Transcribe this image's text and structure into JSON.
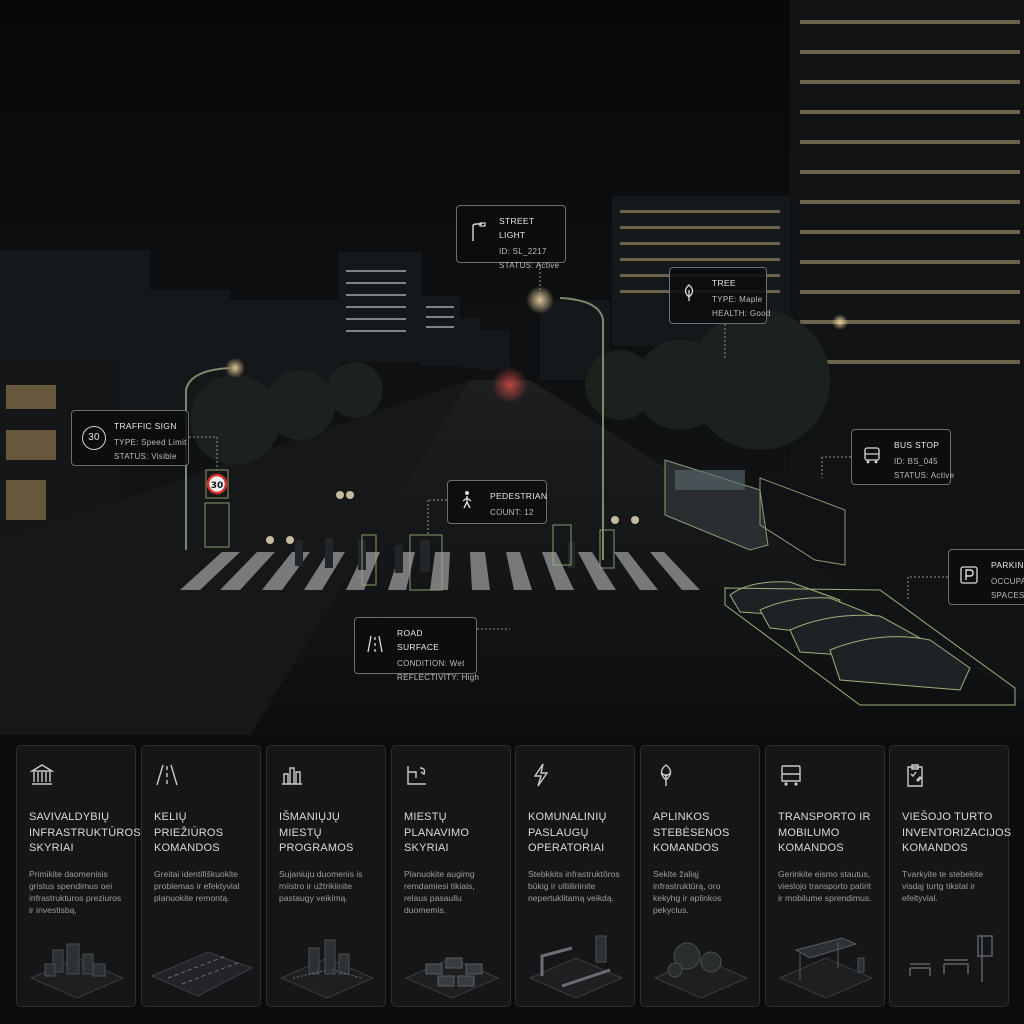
{
  "callouts": {
    "street_light": {
      "title": "STREET LIGHT",
      "line1": "ID: SL_2217",
      "line2": "STATUS: Active"
    },
    "tree": {
      "title": "TREE",
      "line1": "TYPE: Maple",
      "line2": "HEALTH: Good"
    },
    "traffic_sign": {
      "title": "TRAFFIC SIGN",
      "icon_text": "30",
      "line1": "TYPE: Speed Limit",
      "line2": "STATUS: Visible"
    },
    "bus_stop": {
      "title": "BUS STOP",
      "line1": "ID: BS_045",
      "line2": "STATUS: Active"
    },
    "pedestrian": {
      "title": "PEDESTRIAN",
      "line1": "COUNT: 12"
    },
    "parking": {
      "title": "PARKING",
      "line1": "OCCUPA",
      "line2": "SPACES F"
    },
    "road_surface": {
      "title": "ROAD SURFACE",
      "line1": "CONDITION: Wet",
      "line2": "REFLECTIVITY: High"
    },
    "sign_marker": "30"
  },
  "cards": [
    {
      "icon": "bank-icon",
      "title": "SAVIVALDYBIŲ INFRASTRUKTŪROS SKYRIAI",
      "desc": "Primikite daomenisis gristus spendimus oei infrastrukturos preziuros ir investisbą."
    },
    {
      "icon": "road-icon",
      "title": "KELIŲ PRIEŽIŪROS KOMANDOS",
      "desc": "Greitai identifiškuokite problemas ir efektyvial planuokite remontą."
    },
    {
      "icon": "city-chart-icon",
      "title": "IŠMANIŲJŲ MIESTŲ PROGRAMOS",
      "desc": "Sujaniuju duomenis is miistro ir užtrikiinite pastaugy veikimą."
    },
    {
      "icon": "plan-icon",
      "title": "MIESTŲ PLANAVIMO SKYRIAI",
      "desc": "Planuokite augimg remdamiesi tikiais, relaus pasaullu duomemis."
    },
    {
      "icon": "bolt-icon",
      "title": "KOMUNALINIŲ PASLAUGŲ OPERATORIAI",
      "desc": "Stebkkits infrastruktōros būkig ir ultiiliriinite nepertuklitamą veikdą."
    },
    {
      "icon": "leaf-icon",
      "title": "APLINKOS STEBĖSENOS KOMANDOS",
      "desc": "Sekite žaliąj infrastruktūrą, oro kekyhg ir aplinkos pekyclus."
    },
    {
      "icon": "bus-icon",
      "title": "TRANSPORTO IR MOBILUMO KOMANDOS",
      "desc": "Gerinkite eismo stautus, vieslojo transporto patirit ir mobilume sprendimus."
    },
    {
      "icon": "clipboard-icon",
      "title": "VIEŠOJO TURTO INVENTORIZACIJOS KOMANDOS",
      "desc": "Tvarkyite te stebekite visdąį turtg tikstal ir efeltyvial."
    }
  ]
}
